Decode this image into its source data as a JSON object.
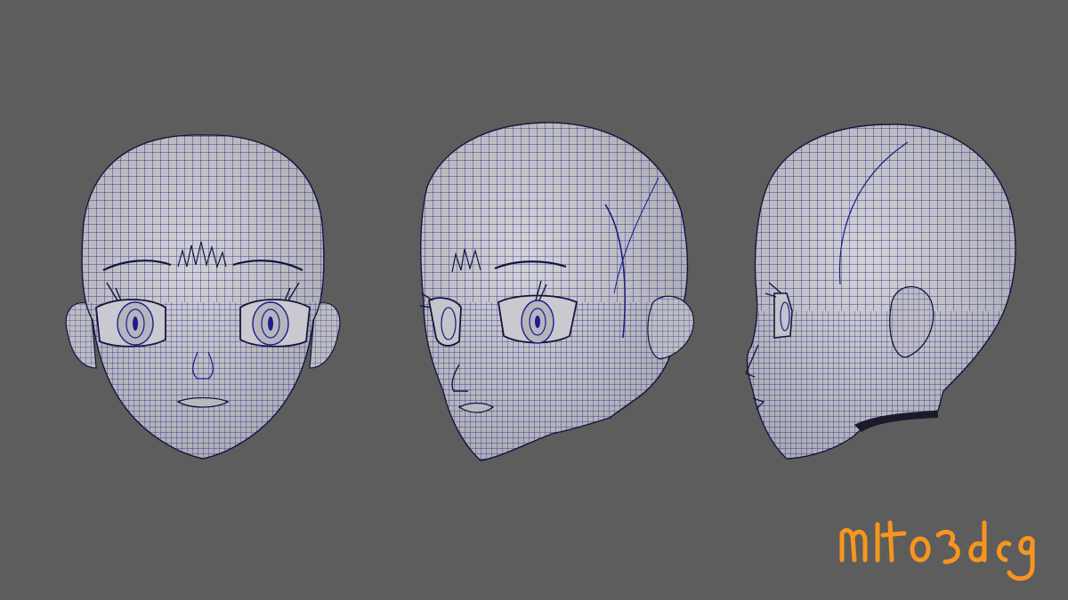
{
  "viewport": {
    "background": "#5d5d5d",
    "view_count": 3
  },
  "model": {
    "surface_color": "#c6c6ca",
    "shade_color": "#9a9aa2",
    "wire_color": "#1c1c8c",
    "outline_color": "#14143c",
    "views": [
      "front",
      "three-quarter",
      "side"
    ]
  },
  "signature": {
    "text": "mito3dcg",
    "color": "#f7951e"
  }
}
